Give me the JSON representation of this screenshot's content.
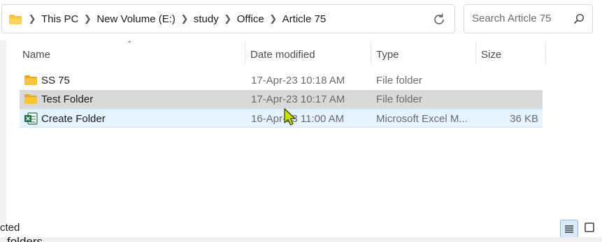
{
  "address": {
    "crumbs": [
      "This PC",
      "New Volume (E:)",
      "study",
      "Office",
      "Article 75"
    ]
  },
  "search": {
    "placeholder": "Search Article 75"
  },
  "columns": {
    "name": "Name",
    "date": "Date modified",
    "type": "Type",
    "size": "Size"
  },
  "files": [
    {
      "name": "SS 75",
      "date": "17-Apr-23 10:18 AM",
      "type": "File folder",
      "size": "",
      "icon": "folder-icon",
      "state": "normal"
    },
    {
      "name": "Test Folder",
      "date": "17-Apr-23 10:17 AM",
      "type": "File folder",
      "size": "",
      "icon": "folder-icon",
      "state": "selected"
    },
    {
      "name": "Create Folder",
      "date": "16-Apr-23 11:00 AM",
      "type": "Microsoft Excel M...",
      "size": "36 KB",
      "icon": "excel-file-icon",
      "state": "hover"
    }
  ],
  "status": {
    "text": "cted"
  },
  "bottom_text": "folders",
  "colors": {
    "selected_row": "#d9d9d9",
    "hover_row": "#e5f3ff",
    "folder": "#f8c53a",
    "excel": "#1d6f42",
    "cursor": "#c8e000"
  }
}
